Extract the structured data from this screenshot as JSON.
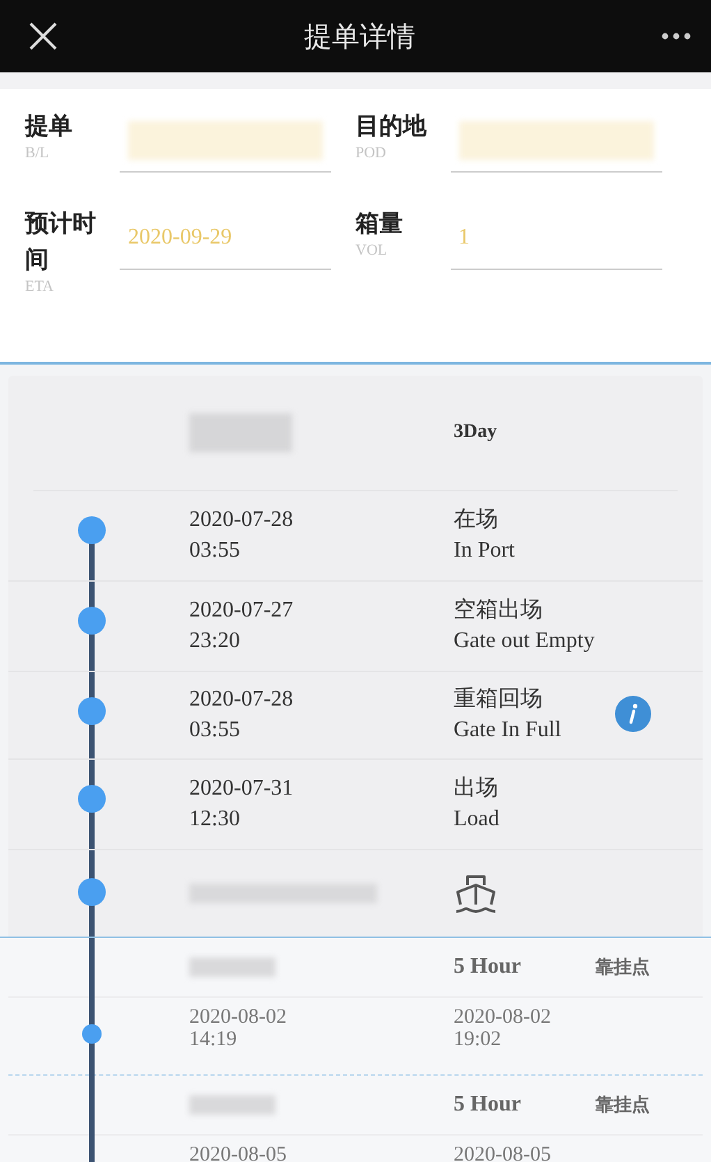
{
  "header": {
    "title": "提单详情"
  },
  "form": {
    "fields": [
      {
        "label": "提单",
        "sublabel": "B/L",
        "redacted": true
      },
      {
        "label": "目的地",
        "sublabel": "POD",
        "redacted": true
      },
      {
        "label": "预计时间",
        "sublabel": "ETA",
        "value": "2020-09-29",
        "redacted": false
      },
      {
        "label": "箱量",
        "sublabel": "VOL",
        "value": "1",
        "redacted": false
      }
    ]
  },
  "timeline": {
    "summary": "3Day",
    "events": [
      {
        "date": "2020-07-28",
        "time": "03:55",
        "title": "在场",
        "subtitle": "In Port",
        "info": false
      },
      {
        "date": "2020-07-27",
        "time": "23:20",
        "title": "空箱出场",
        "subtitle": "Gate out Empty",
        "info": false
      },
      {
        "date": "2020-07-28",
        "time": "03:55",
        "title": "重箱回场",
        "subtitle": "Gate In Full",
        "info": true
      },
      {
        "date": "2020-07-31",
        "time": "12:30",
        "title": "出场",
        "subtitle": "Load",
        "info": false
      }
    ]
  },
  "stops": [
    {
      "duration": "5 Hour",
      "label": "靠挂点",
      "arrival": [
        "2020-08-02",
        "14:19"
      ],
      "departure": [
        "2020-08-02",
        "19:02"
      ]
    },
    {
      "duration": "5 Hour",
      "label": "靠挂点",
      "arrival": [
        "2020-08-05"
      ],
      "departure": [
        "2020-08-05"
      ]
    }
  ]
}
